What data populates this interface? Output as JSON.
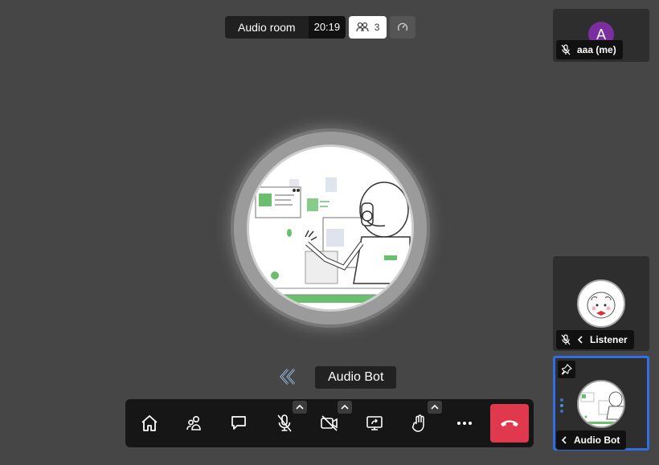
{
  "header": {
    "room_name": "Audio room",
    "timer": "20:19",
    "participant_count": "3"
  },
  "stage": {
    "speaker_name": "Audio Bot"
  },
  "tiles": [
    {
      "name": "aaa (me)",
      "avatar_letter": "A",
      "muted": true
    },
    {
      "name": "Listener",
      "muted": true
    },
    {
      "name": "Audio Bot",
      "pinned": true,
      "active": true
    }
  ],
  "colors": {
    "background": "#464646",
    "hangup": "#e0394e",
    "active_tile_border": "#2f6fe3",
    "self_avatar": "#7b2ea0"
  },
  "toolbar": {
    "buttons": [
      "home-icon",
      "participants-icon",
      "chat-icon",
      "microphone-off-icon",
      "camera-off-icon",
      "share-screen-icon",
      "raise-hand-icon",
      "more-icon",
      "hangup-icon"
    ]
  }
}
